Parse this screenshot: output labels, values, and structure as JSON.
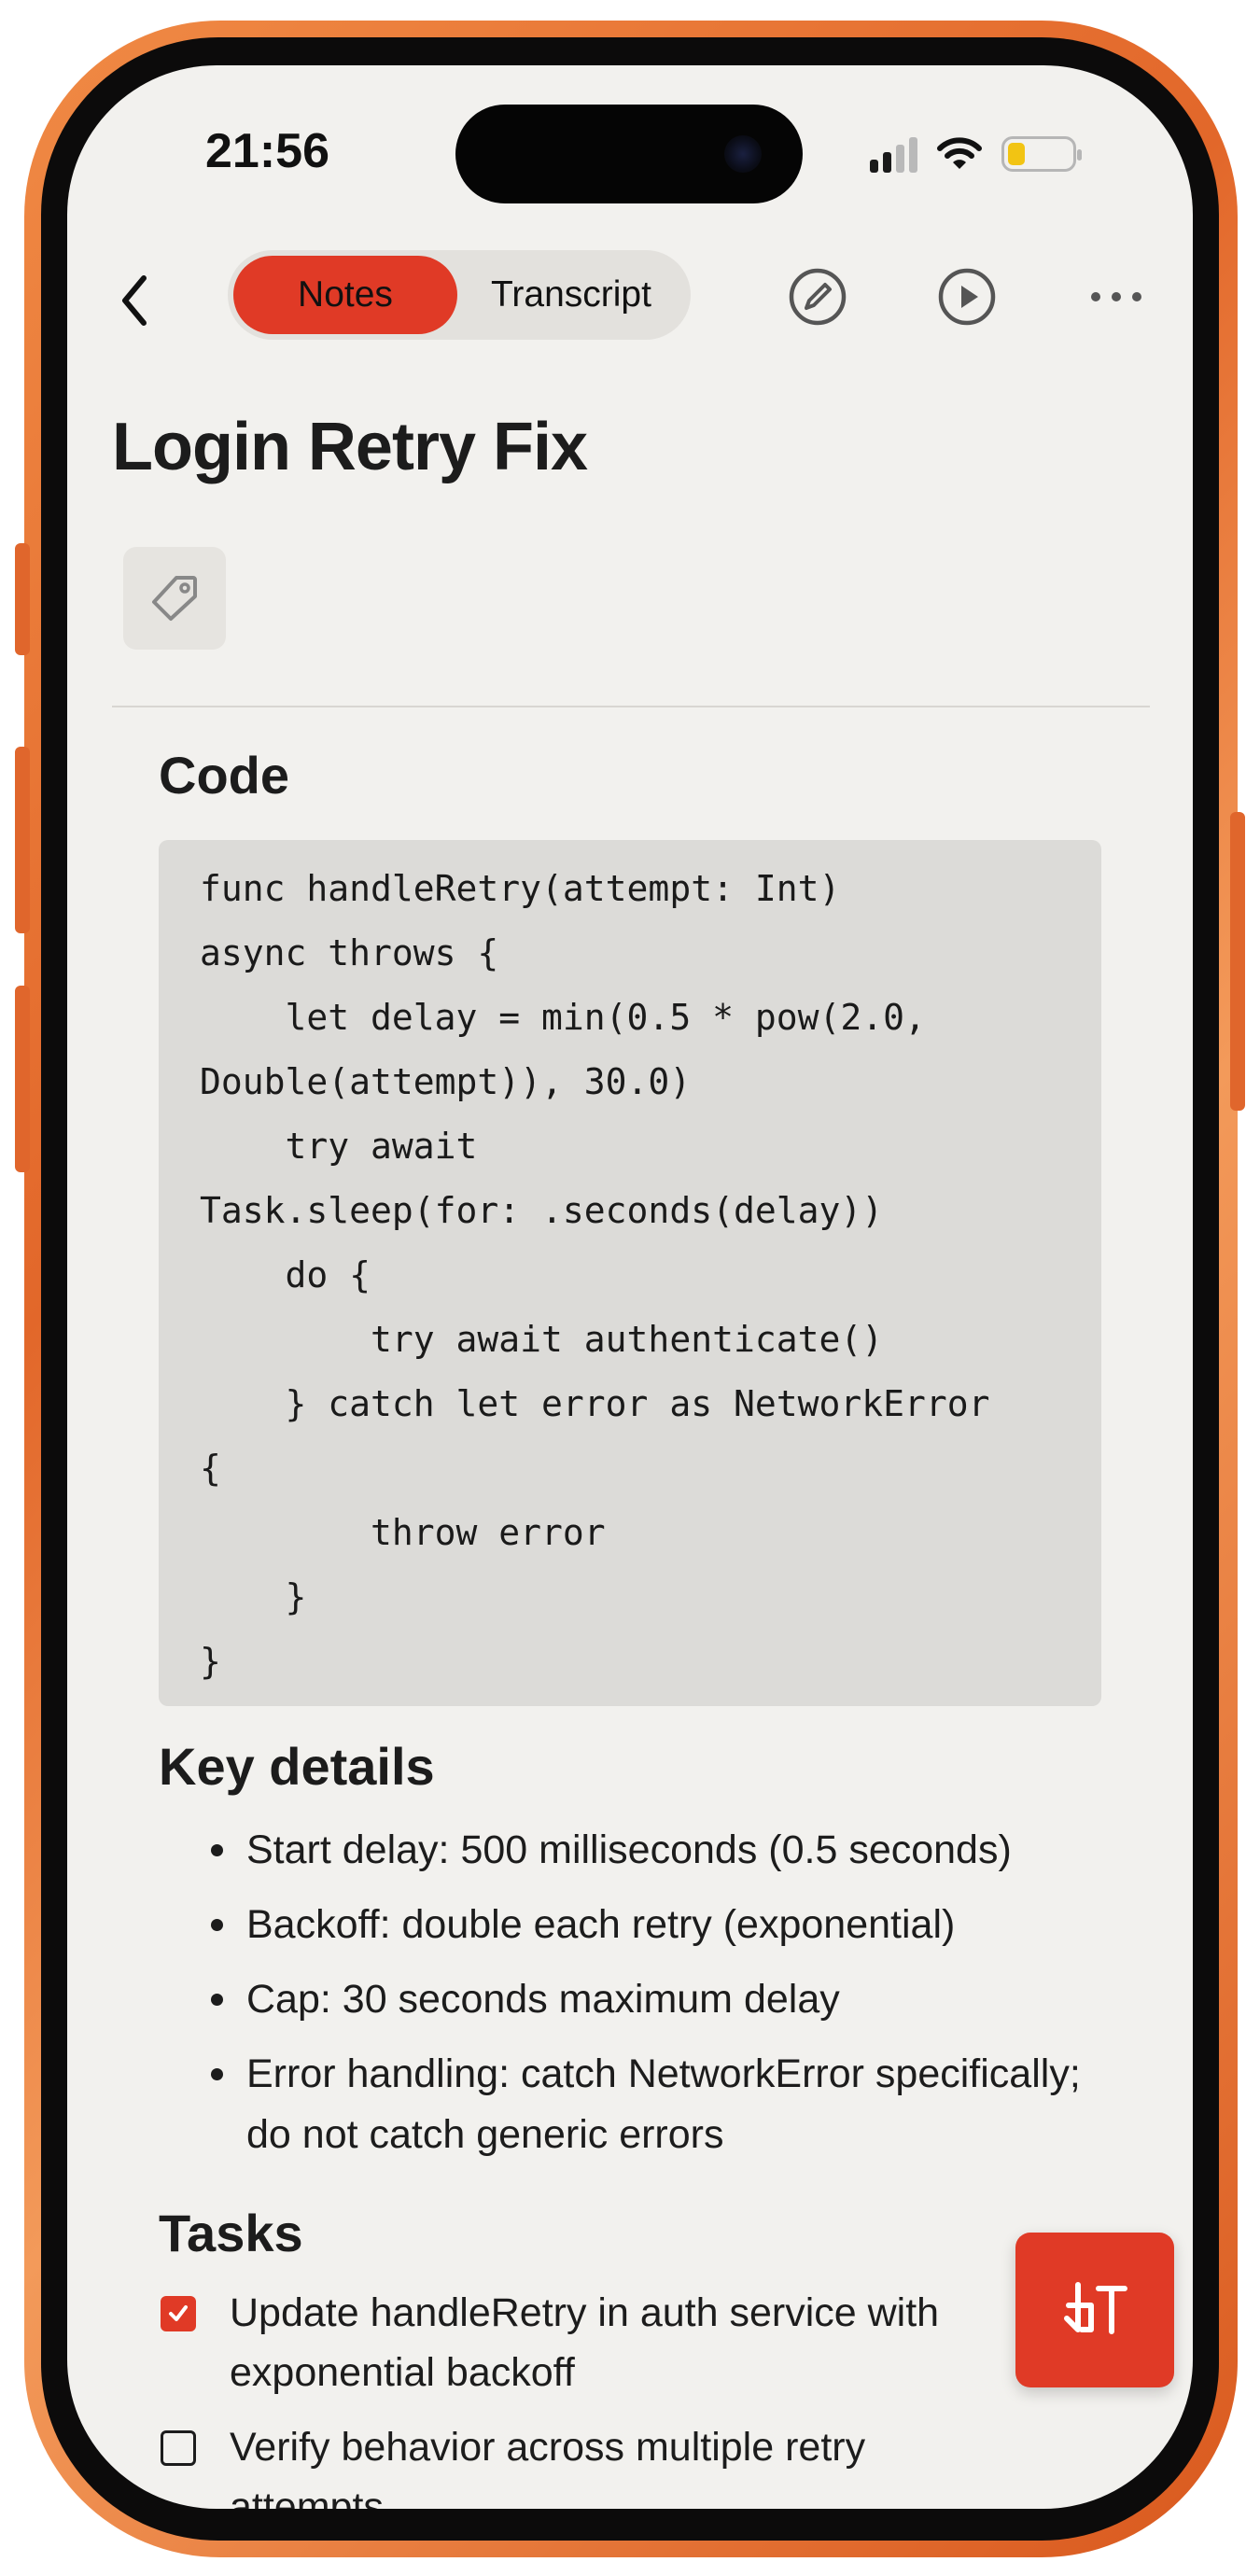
{
  "status_bar": {
    "time": "21:56"
  },
  "toolbar": {
    "back_icon": "chevron-left-icon",
    "tabs": [
      {
        "label": "Notes",
        "active": true
      },
      {
        "label": "Transcript",
        "active": false
      }
    ],
    "edit_icon": "pencil-circle-icon",
    "play_icon": "play-circle-icon",
    "more_icon": "ellipsis-icon"
  },
  "note": {
    "title": "Login Retry Fix",
    "tag_icon": "tag-icon"
  },
  "code_section": {
    "heading": "Code",
    "lines": [
      "func handleRetry(attempt: Int)",
      "async throws {",
      "    let delay = min(0.5 * pow(2.0,",
      "Double(attempt)), 30.0)",
      "    try await",
      "Task.sleep(for: .seconds(delay))",
      "    do {",
      "        try await authenticate()",
      "    } catch let error as NetworkError",
      "{",
      "        throw error",
      "    }",
      "}"
    ]
  },
  "key_details": {
    "heading": "Key details",
    "items": [
      "Start delay: 500 milliseconds (0.5 seconds)",
      "Backoff: double each retry (exponential)",
      "Cap: 30 seconds maximum delay",
      "Error handling: catch NetworkError specifically; do not catch generic errors"
    ]
  },
  "tasks": {
    "heading": "Tasks",
    "items": [
      {
        "text": "Update handleRetry in auth service with exponential backoff",
        "checked": true
      },
      {
        "text": "Verify behavior across multiple retry attempts",
        "checked": false
      }
    ]
  },
  "fab": {
    "icon": "transcribe-icon"
  },
  "colors": {
    "accent": "#e03a26",
    "background": "#f2f1ee",
    "code_bg": "#dcdbd8",
    "frame": "#e2672a"
  }
}
